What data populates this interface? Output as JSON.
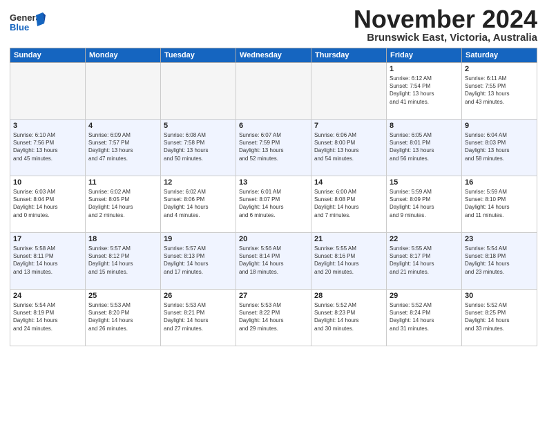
{
  "header": {
    "logo_line1": "General",
    "logo_line2": "Blue",
    "month_title": "November 2024",
    "location": "Brunswick East, Victoria, Australia"
  },
  "weekdays": [
    "Sunday",
    "Monday",
    "Tuesday",
    "Wednesday",
    "Thursday",
    "Friday",
    "Saturday"
  ],
  "weeks": [
    [
      {
        "day": "",
        "info": ""
      },
      {
        "day": "",
        "info": ""
      },
      {
        "day": "",
        "info": ""
      },
      {
        "day": "",
        "info": ""
      },
      {
        "day": "",
        "info": ""
      },
      {
        "day": "1",
        "info": "Sunrise: 6:12 AM\nSunset: 7:54 PM\nDaylight: 13 hours\nand 41 minutes."
      },
      {
        "day": "2",
        "info": "Sunrise: 6:11 AM\nSunset: 7:55 PM\nDaylight: 13 hours\nand 43 minutes."
      }
    ],
    [
      {
        "day": "3",
        "info": "Sunrise: 6:10 AM\nSunset: 7:56 PM\nDaylight: 13 hours\nand 45 minutes."
      },
      {
        "day": "4",
        "info": "Sunrise: 6:09 AM\nSunset: 7:57 PM\nDaylight: 13 hours\nand 47 minutes."
      },
      {
        "day": "5",
        "info": "Sunrise: 6:08 AM\nSunset: 7:58 PM\nDaylight: 13 hours\nand 50 minutes."
      },
      {
        "day": "6",
        "info": "Sunrise: 6:07 AM\nSunset: 7:59 PM\nDaylight: 13 hours\nand 52 minutes."
      },
      {
        "day": "7",
        "info": "Sunrise: 6:06 AM\nSunset: 8:00 PM\nDaylight: 13 hours\nand 54 minutes."
      },
      {
        "day": "8",
        "info": "Sunrise: 6:05 AM\nSunset: 8:01 PM\nDaylight: 13 hours\nand 56 minutes."
      },
      {
        "day": "9",
        "info": "Sunrise: 6:04 AM\nSunset: 8:03 PM\nDaylight: 13 hours\nand 58 minutes."
      }
    ],
    [
      {
        "day": "10",
        "info": "Sunrise: 6:03 AM\nSunset: 8:04 PM\nDaylight: 14 hours\nand 0 minutes."
      },
      {
        "day": "11",
        "info": "Sunrise: 6:02 AM\nSunset: 8:05 PM\nDaylight: 14 hours\nand 2 minutes."
      },
      {
        "day": "12",
        "info": "Sunrise: 6:02 AM\nSunset: 8:06 PM\nDaylight: 14 hours\nand 4 minutes."
      },
      {
        "day": "13",
        "info": "Sunrise: 6:01 AM\nSunset: 8:07 PM\nDaylight: 14 hours\nand 6 minutes."
      },
      {
        "day": "14",
        "info": "Sunrise: 6:00 AM\nSunset: 8:08 PM\nDaylight: 14 hours\nand 7 minutes."
      },
      {
        "day": "15",
        "info": "Sunrise: 5:59 AM\nSunset: 8:09 PM\nDaylight: 14 hours\nand 9 minutes."
      },
      {
        "day": "16",
        "info": "Sunrise: 5:59 AM\nSunset: 8:10 PM\nDaylight: 14 hours\nand 11 minutes."
      }
    ],
    [
      {
        "day": "17",
        "info": "Sunrise: 5:58 AM\nSunset: 8:11 PM\nDaylight: 14 hours\nand 13 minutes."
      },
      {
        "day": "18",
        "info": "Sunrise: 5:57 AM\nSunset: 8:12 PM\nDaylight: 14 hours\nand 15 minutes."
      },
      {
        "day": "19",
        "info": "Sunrise: 5:57 AM\nSunset: 8:13 PM\nDaylight: 14 hours\nand 17 minutes."
      },
      {
        "day": "20",
        "info": "Sunrise: 5:56 AM\nSunset: 8:14 PM\nDaylight: 14 hours\nand 18 minutes."
      },
      {
        "day": "21",
        "info": "Sunrise: 5:55 AM\nSunset: 8:16 PM\nDaylight: 14 hours\nand 20 minutes."
      },
      {
        "day": "22",
        "info": "Sunrise: 5:55 AM\nSunset: 8:17 PM\nDaylight: 14 hours\nand 21 minutes."
      },
      {
        "day": "23",
        "info": "Sunrise: 5:54 AM\nSunset: 8:18 PM\nDaylight: 14 hours\nand 23 minutes."
      }
    ],
    [
      {
        "day": "24",
        "info": "Sunrise: 5:54 AM\nSunset: 8:19 PM\nDaylight: 14 hours\nand 24 minutes."
      },
      {
        "day": "25",
        "info": "Sunrise: 5:53 AM\nSunset: 8:20 PM\nDaylight: 14 hours\nand 26 minutes."
      },
      {
        "day": "26",
        "info": "Sunrise: 5:53 AM\nSunset: 8:21 PM\nDaylight: 14 hours\nand 27 minutes."
      },
      {
        "day": "27",
        "info": "Sunrise: 5:53 AM\nSunset: 8:22 PM\nDaylight: 14 hours\nand 29 minutes."
      },
      {
        "day": "28",
        "info": "Sunrise: 5:52 AM\nSunset: 8:23 PM\nDaylight: 14 hours\nand 30 minutes."
      },
      {
        "day": "29",
        "info": "Sunrise: 5:52 AM\nSunset: 8:24 PM\nDaylight: 14 hours\nand 31 minutes."
      },
      {
        "day": "30",
        "info": "Sunrise: 5:52 AM\nSunset: 8:25 PM\nDaylight: 14 hours\nand 33 minutes."
      }
    ]
  ]
}
